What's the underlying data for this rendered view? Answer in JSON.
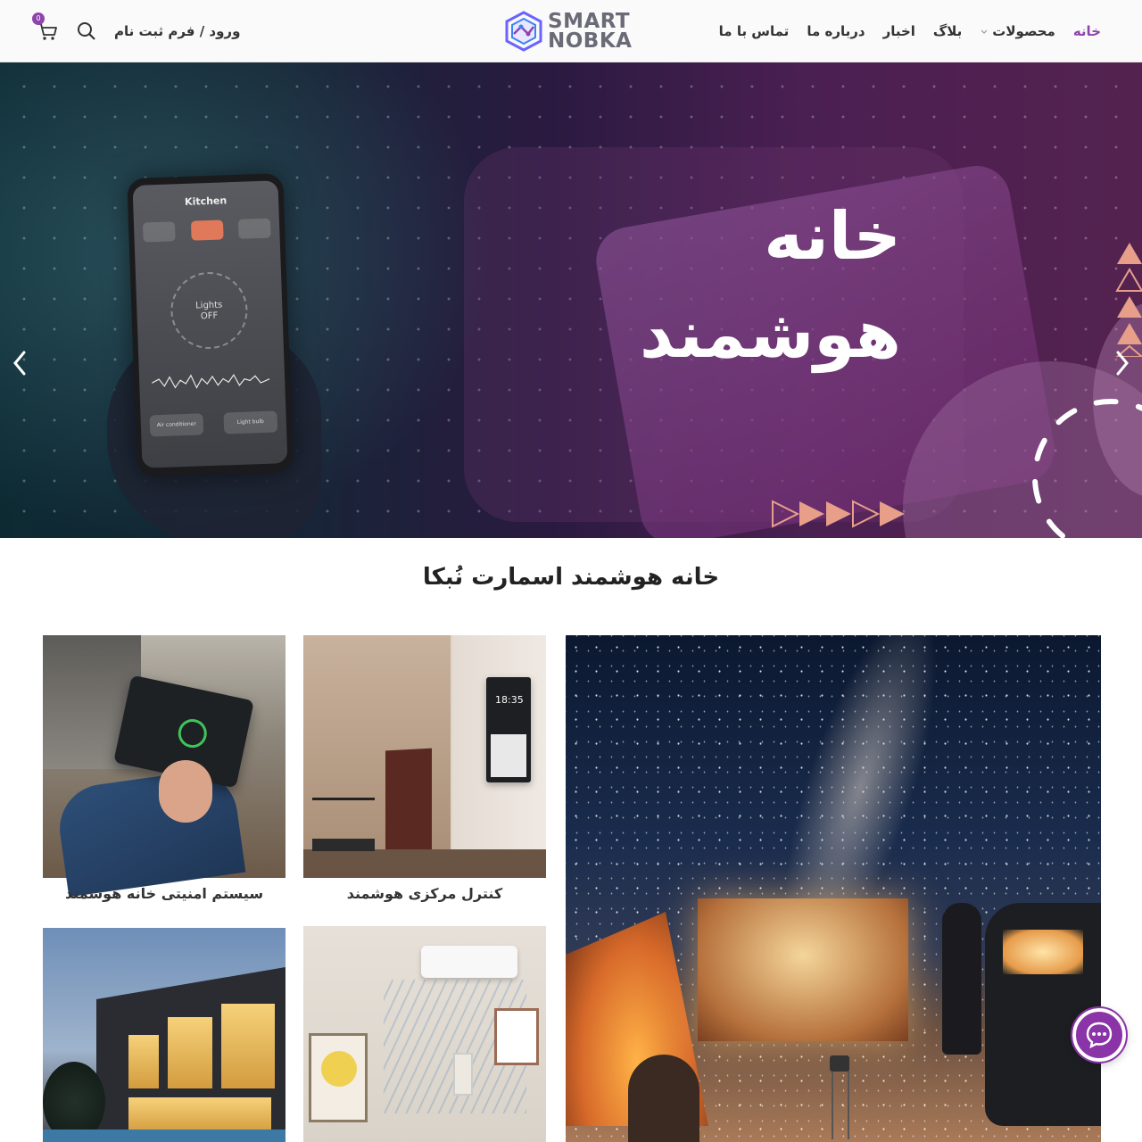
{
  "header": {
    "nav": [
      {
        "label": "خانه"
      },
      {
        "label": "محصولات"
      },
      {
        "label": "بلاگ"
      },
      {
        "label": "اخبار"
      },
      {
        "label": "درباره ما"
      },
      {
        "label": "تماس با ما"
      }
    ],
    "active_nav": "خانه",
    "logo": {
      "line1": "SMART",
      "line2": "NOBKA"
    },
    "login_label": "ورود / فرم ثبت نام",
    "cart_count": "0",
    "accent_color": "#8e44ad"
  },
  "hero": {
    "title_line1": "خانه",
    "title_line2": "هوشمند",
    "phone": {
      "screen_title": "Kitchen",
      "lights_line1": "Lights",
      "lights_line2": "OFF",
      "device1": "Light bulb",
      "device2": "Air conditioner"
    },
    "slides_total": 3,
    "active_slide": 3
  },
  "section": {
    "title": "خانه هوشمند اسمارت نُبکا",
    "cards": [
      {
        "caption": "سیستم امنیتی خانه هوشمند",
        "image": "tablet-security-app"
      },
      {
        "caption": "کنترل مرکزی هوشمند",
        "image": "wall-control-panel",
        "clock": "18:35"
      },
      {
        "caption": "",
        "image": "modern-house-night"
      },
      {
        "caption": "",
        "image": "air-conditioner-room"
      },
      {
        "caption": "",
        "image": "outdoor-projector-camping"
      }
    ]
  },
  "icons": {
    "cart": "cart-icon",
    "search": "search-icon",
    "chat": "chat-icon",
    "prev": "chevron-left-icon",
    "next": "chevron-right-icon"
  }
}
